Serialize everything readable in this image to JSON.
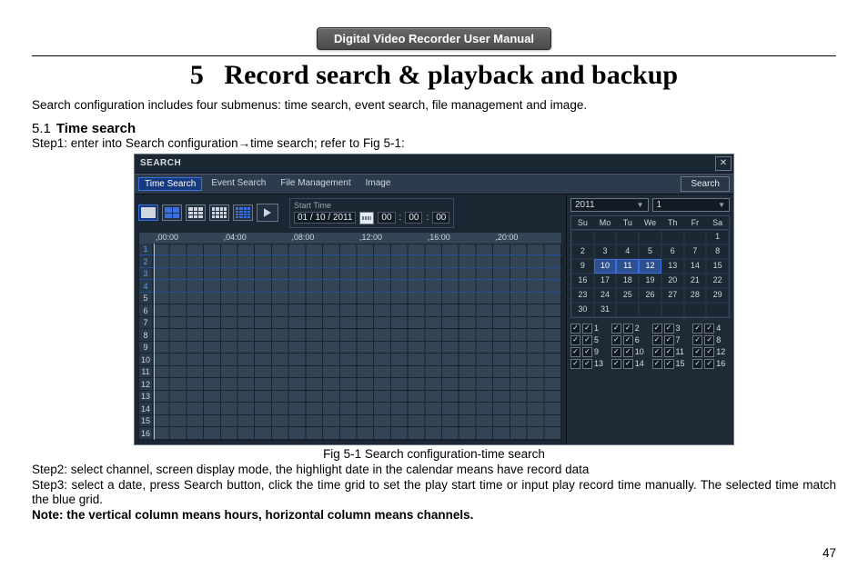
{
  "header": {
    "badge": "Digital Video Recorder User Manual"
  },
  "chapter": {
    "number": "5",
    "title": "Record search & playback and backup"
  },
  "intro": "Search configuration includes four submenus: time search, event search, file management and image.",
  "section": {
    "number": "5.1",
    "title": "Time search"
  },
  "step1": "Step1: enter into Search configuration→time search; refer to Fig 5-1:",
  "figure_caption": "Fig 5-1 Search configuration-time search",
  "step2": "Step2: select channel, screen display mode, the highlight date in the calendar means have record data",
  "step3": "Step3: select a date, press Search button, click the time grid to set the play start time or input play record time manually. The selected time match the blue grid.",
  "note": "Note: the vertical column means hours, horizontal column means channels.",
  "page_number": "47",
  "screenshot": {
    "window_title": "SEARCH",
    "tabs": [
      "Time Search",
      "Event Search",
      "File Management",
      "Image"
    ],
    "active_tab_index": 0,
    "search_button": "Search",
    "start_time_label": "Start Time",
    "date_value": "01 / 10 / 2011",
    "time_value_h": "00",
    "time_value_m": "00",
    "time_value_s": "00",
    "hours": [
      ",00:00",
      ",04:00",
      ",08:00",
      ",12:00",
      ",16:00",
      ",20:00"
    ],
    "channels": [
      "1",
      "2",
      "3",
      "4",
      "5",
      "6",
      "7",
      "8",
      "9",
      "10",
      "11",
      "12",
      "13",
      "14",
      "15",
      "16"
    ],
    "highlighted_rows": [
      0,
      1,
      2,
      3
    ],
    "year": "2011",
    "month": "1",
    "dow": [
      "Su",
      "Mo",
      "Tu",
      "We",
      "Th",
      "Fr",
      "Sa"
    ],
    "calendar": [
      [
        "",
        "",
        "",
        "",
        "",
        "",
        "1"
      ],
      [
        "2",
        "3",
        "4",
        "5",
        "6",
        "7",
        "8"
      ],
      [
        "9",
        "10",
        "11",
        "12",
        "13",
        "14",
        "15"
      ],
      [
        "16",
        "17",
        "18",
        "19",
        "20",
        "21",
        "22"
      ],
      [
        "23",
        "24",
        "25",
        "26",
        "27",
        "28",
        "29"
      ],
      [
        "30",
        "31",
        "",
        "",
        "",
        "",
        ""
      ]
    ],
    "highlight_days": [
      "10",
      "11",
      "12"
    ],
    "channel_checks": [
      "1",
      "2",
      "3",
      "4",
      "5",
      "6",
      "7",
      "8",
      "9",
      "10",
      "11",
      "12",
      "13",
      "14",
      "15",
      "16"
    ]
  }
}
